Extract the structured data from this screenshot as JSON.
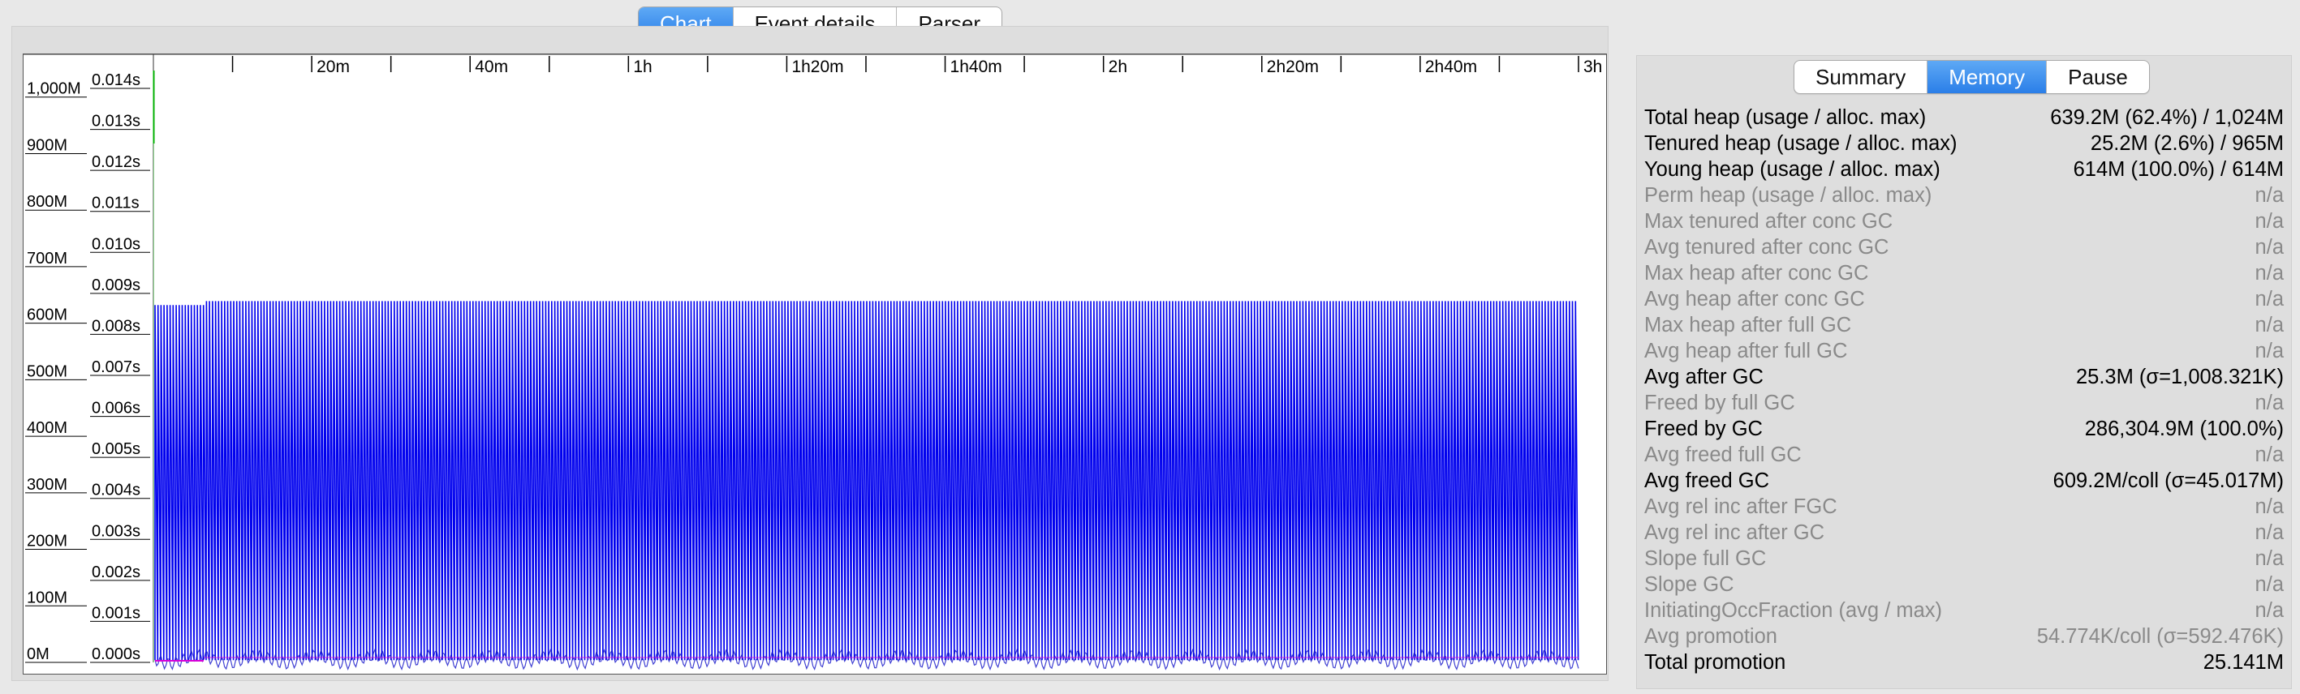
{
  "top_tabs": [
    {
      "label": "Chart",
      "active": true
    },
    {
      "label": "Event details",
      "active": false
    },
    {
      "label": "Parser",
      "active": false
    }
  ],
  "right_tabs": [
    {
      "label": "Summary",
      "active": false
    },
    {
      "label": "Memory",
      "active": true
    },
    {
      "label": "Pause",
      "active": false
    }
  ],
  "memory_stats": [
    {
      "label": "Total heap (usage / alloc. max)",
      "value": "639.2M (62.4%) / 1,024M",
      "enabled": true
    },
    {
      "label": "Tenured heap (usage / alloc. max)",
      "value": "25.2M (2.6%) / 965M",
      "enabled": true
    },
    {
      "label": "Young heap (usage / alloc. max)",
      "value": "614M (100.0%) / 614M",
      "enabled": true
    },
    {
      "label": "Perm heap (usage / alloc. max)",
      "value": "n/a",
      "enabled": false
    },
    {
      "label": "Max tenured after conc GC",
      "value": "n/a",
      "enabled": false
    },
    {
      "label": "Avg tenured after conc GC",
      "value": "n/a",
      "enabled": false
    },
    {
      "label": "Max heap after conc GC",
      "value": "n/a",
      "enabled": false
    },
    {
      "label": "Avg heap after conc GC",
      "value": "n/a",
      "enabled": false
    },
    {
      "label": "Max heap after full GC",
      "value": "n/a",
      "enabled": false
    },
    {
      "label": "Avg heap after full GC",
      "value": "n/a",
      "enabled": false
    },
    {
      "label": "Avg after GC",
      "value": "25.3M (σ=1,008.321K)",
      "enabled": true
    },
    {
      "label": "Freed by full GC",
      "value": "n/a",
      "enabled": false
    },
    {
      "label": "Freed by GC",
      "value": "286,304.9M (100.0%)",
      "enabled": true
    },
    {
      "label": "Avg freed full GC",
      "value": "n/a",
      "enabled": false
    },
    {
      "label": "Avg freed GC",
      "value": "609.2M/coll (σ=45.017M)",
      "enabled": true
    },
    {
      "label": "Avg rel inc after FGC",
      "value": "n/a",
      "enabled": false
    },
    {
      "label": "Avg rel inc after GC",
      "value": "n/a",
      "enabled": false
    },
    {
      "label": "Slope full GC",
      "value": "n/a",
      "enabled": false
    },
    {
      "label": "Slope GC",
      "value": "n/a",
      "enabled": false
    },
    {
      "label": "InitiatingOccFraction (avg / max)",
      "value": "n/a",
      "enabled": false
    },
    {
      "label": "Avg promotion",
      "value": "54.774K/coll (σ=592.476K)",
      "enabled": false
    },
    {
      "label": "Total promotion",
      "value": "25.141M",
      "enabled": true
    }
  ],
  "chart_data": {
    "type": "line",
    "x_ticks": [
      "20m",
      "40m",
      "1h",
      "1h20m",
      "1h40m",
      "2h",
      "2h20m",
      "2h40m",
      "3h"
    ],
    "y_ticks_memory": [
      "1,000M",
      "900M",
      "800M",
      "700M",
      "600M",
      "500M",
      "400M",
      "300M",
      "200M",
      "100M",
      "0M"
    ],
    "y_ticks_pause": [
      "0.014s",
      "0.013s",
      "0.012s",
      "0.011s",
      "0.010s",
      "0.009s",
      "0.008s",
      "0.007s",
      "0.006s",
      "0.005s",
      "0.004s",
      "0.003s",
      "0.002s",
      "0.001s",
      "0.000s"
    ],
    "xlim_minutes": [
      0,
      180
    ],
    "ylim_memory_M": [
      0,
      1024
    ],
    "ylim_pause_s": [
      0,
      0.0145
    ],
    "series": [
      {
        "color": "#0000ee",
        "start_minutes": 0.2,
        "end_minutes": 180,
        "first_peak_M": 639,
        "peak_M": 639,
        "trough_M": 25
      }
    ],
    "colors": {
      "heap": "#0000ee",
      "tenured": "#d800d8",
      "pause_marker": "#00b000",
      "pause_marker_light": "#8ed88e"
    }
  }
}
